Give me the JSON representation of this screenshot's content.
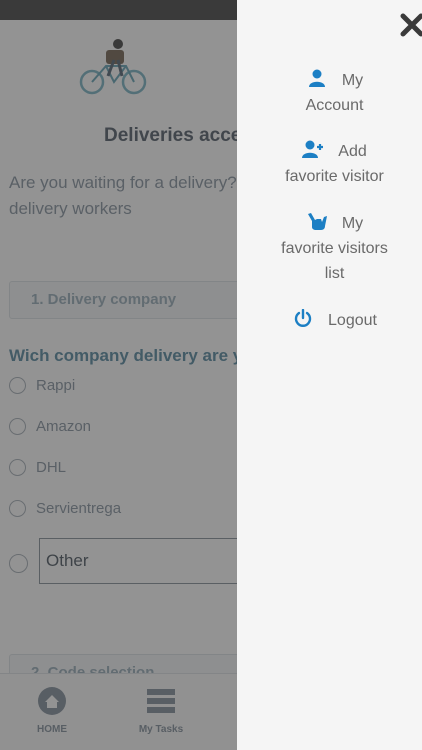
{
  "background": {
    "page_title": "Deliveries access",
    "intro_text": "Are you waiting for a delivery? Request access for delivery workers",
    "step1_label": "1. Delivery company",
    "question": "Wich company delivery are you waiting?",
    "options": [
      "Rappi",
      "Amazon",
      "DHL",
      "Servientrega"
    ],
    "other_value": "Other",
    "step2_label": "2. Code selection"
  },
  "tabbar": {
    "home_label": "HOME",
    "tasks_label": "My Tasks"
  },
  "menu": {
    "items": [
      {
        "label_line1": "My",
        "label_line2": "Account",
        "icon": "user-icon"
      },
      {
        "label_line1": "Add",
        "label_line2": "favorite visitor",
        "icon": "add-user-icon"
      },
      {
        "label_line1": "My",
        "label_line2": "favorite visitors",
        "label_line3": "list",
        "icon": "hang-loose-hand-icon"
      },
      {
        "label_line1": "Logout",
        "icon": "power-icon"
      }
    ]
  },
  "colors": {
    "icon_blue": "#1c7fc4",
    "drawer_bg": "#f5f5f5",
    "status_bar": "#4c4c4c"
  }
}
